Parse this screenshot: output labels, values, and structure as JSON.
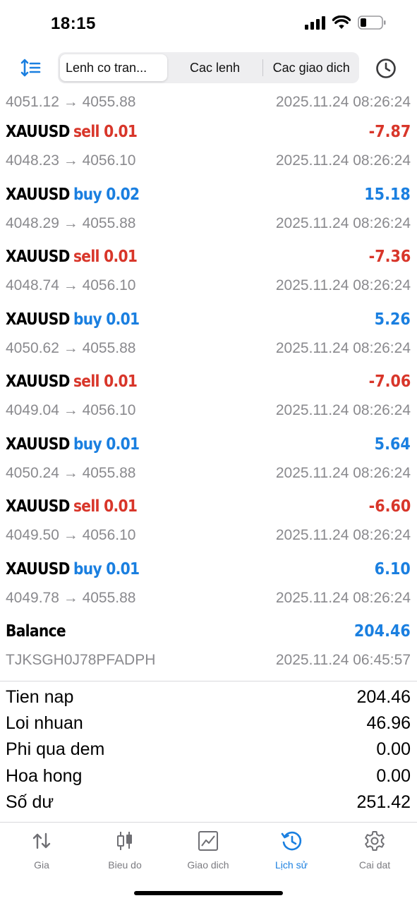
{
  "status_bar": {
    "time": "18:15"
  },
  "toolbar": {
    "segments": [
      "Lenh co tran...",
      "Cac lenh",
      "Cac giao dich"
    ],
    "sort_icon": "sort-icon",
    "history_icon": "clock-icon"
  },
  "first_row": {
    "prices": "4051.12 → 4055.88",
    "time": "2025.11.24 08:26:24"
  },
  "deals": [
    {
      "symbol": "XAUUSD",
      "side": "sell 0.01",
      "profit": "-7.87",
      "prices": "4048.23 → 4056.10",
      "time": "2025.11.24 08:26:24"
    },
    {
      "symbol": "XAUUSD",
      "side": "buy 0.02",
      "profit": "15.18",
      "prices": "4048.29 → 4055.88",
      "time": "2025.11.24 08:26:24"
    },
    {
      "symbol": "XAUUSD",
      "side": "sell 0.01",
      "profit": "-7.36",
      "prices": "4048.74 → 4056.10",
      "time": "2025.11.24 08:26:24"
    },
    {
      "symbol": "XAUUSD",
      "side": "buy 0.01",
      "profit": "5.26",
      "prices": "4050.62 → 4055.88",
      "time": "2025.11.24 08:26:24"
    },
    {
      "symbol": "XAUUSD",
      "side": "sell 0.01",
      "profit": "-7.06",
      "prices": "4049.04 → 4056.10",
      "time": "2025.11.24 08:26:24"
    },
    {
      "symbol": "XAUUSD",
      "side": "buy 0.01",
      "profit": "5.64",
      "prices": "4050.24 → 4055.88",
      "time": "2025.11.24 08:26:24"
    },
    {
      "symbol": "XAUUSD",
      "side": "sell 0.01",
      "profit": "-6.60",
      "prices": "4049.50 → 4056.10",
      "time": "2025.11.24 08:26:24"
    },
    {
      "symbol": "XAUUSD",
      "side": "buy 0.01",
      "profit": "6.10",
      "prices": "4049.78 → 4055.88",
      "time": "2025.11.24 08:26:24"
    }
  ],
  "balance_row": {
    "label": "Balance",
    "amount": "204.46",
    "ref": "TJKSGH0J78PFADPH",
    "time": "2025.11.24 06:45:57"
  },
  "summary": [
    {
      "label": "Tien nap",
      "value": "204.46"
    },
    {
      "label": "Loi nhuan",
      "value": "46.96"
    },
    {
      "label": "Phi qua dem",
      "value": "0.00"
    },
    {
      "label": "Hoa hong",
      "value": "0.00"
    },
    {
      "label": "Số dư",
      "value": "251.42"
    }
  ],
  "tabbar": [
    {
      "label": "Gia",
      "icon": "quotes-icon"
    },
    {
      "label": "Bieu do",
      "icon": "candlestick-icon"
    },
    {
      "label": "Giao dich",
      "icon": "trade-chart-icon"
    },
    {
      "label": "Lịch sử",
      "icon": "history-icon"
    },
    {
      "label": "Cai dat",
      "icon": "gear-icon"
    }
  ],
  "colors": {
    "sell": "#d8362a",
    "buy": "#1a7fe0",
    "accent": "#1a7fe0",
    "muted": "#8a8a8e"
  }
}
